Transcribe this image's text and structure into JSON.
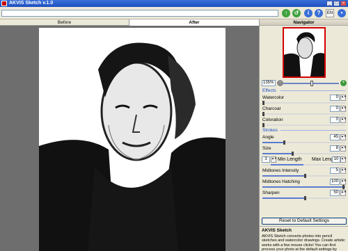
{
  "window": {
    "title": "AKVIS Sketch v.1.0"
  },
  "toolbar": {
    "path_value": "",
    "lang_label": "EN"
  },
  "tabs": {
    "before": "Before",
    "after": "After"
  },
  "navigator": {
    "title": "Navigator",
    "zoom": "135%"
  },
  "effects": {
    "title": "Effects",
    "watercolor": {
      "label": "Watercolor",
      "value": "0"
    },
    "charcoal": {
      "label": "Charcoal",
      "value": "0"
    },
    "coloration": {
      "label": "Coloration",
      "value": "0"
    }
  },
  "strokes": {
    "title": "Strokes",
    "angle": {
      "label": "Angle",
      "value": "45"
    },
    "size": {
      "label": "Size",
      "value": "8"
    },
    "min_length": {
      "label": "Min Length",
      "value": "3"
    },
    "max_length": {
      "label": "Max Length",
      "value": "10"
    },
    "midtones_intensity": {
      "label": "Midtones Intensity",
      "value": "5"
    },
    "midtones_hatching": {
      "label": "Midtones Hatching",
      "value": "100"
    },
    "sharpen": {
      "label": "Sharpen",
      "value": "50"
    }
  },
  "reset_label": "Reset to Default Settings",
  "help": {
    "title": "AKVIS Sketch",
    "text": "AKVIS Sketch converts photos into pencil sketches and watercolor drawings. Create artistic works with a few mouse clicks! You can first process your photo at the default settings by pressing the green button Run. Then adjust the parameters as you like."
  },
  "colors": {
    "accent": "#1f4fcf",
    "titlebar": "#1d4fc0",
    "frame_red": "#d40000"
  }
}
